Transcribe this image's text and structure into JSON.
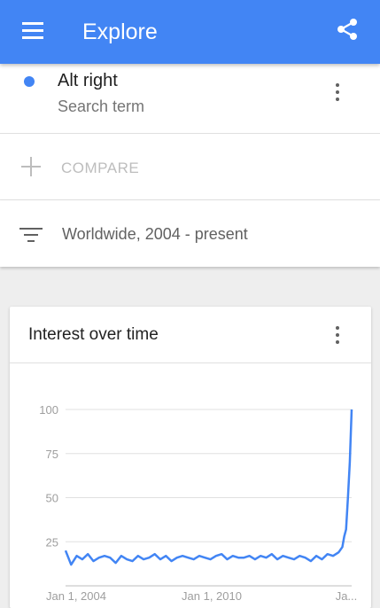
{
  "appbar": {
    "title": "Explore",
    "menu_icon": "menu-icon",
    "share_icon": "share-icon",
    "color": "#4285f4"
  },
  "search_term": {
    "name": "Alt right",
    "type": "Search term",
    "dot_color": "#4285f4"
  },
  "compare": {
    "label": "COMPARE"
  },
  "filter": {
    "label": "Worldwide, 2004 - present"
  },
  "card": {
    "title": "Interest over time"
  },
  "chart_data": {
    "type": "line",
    "title": "Interest over time",
    "xlabel": "",
    "ylabel": "",
    "ylim": [
      0,
      100
    ],
    "yticks": [
      "25",
      "50",
      "75",
      "100"
    ],
    "xticks": [
      "Jan 1, 2004",
      "Jan 1, 2010",
      "Ja..."
    ],
    "grid": true,
    "series": [
      {
        "color": "#4285f4",
        "x": [
          "2004-01",
          "2004-04",
          "2004-07",
          "2004-10",
          "2005-01",
          "2005-04",
          "2005-07",
          "2005-10",
          "2006-01",
          "2006-04",
          "2006-07",
          "2006-10",
          "2007-01",
          "2007-04",
          "2007-07",
          "2007-10",
          "2008-01",
          "2008-04",
          "2008-07",
          "2008-10",
          "2009-01",
          "2009-04",
          "2009-07",
          "2009-10",
          "2010-01",
          "2010-04",
          "2010-07",
          "2010-10",
          "2011-01",
          "2011-04",
          "2011-07",
          "2011-10",
          "2012-01",
          "2012-04",
          "2012-07",
          "2012-10",
          "2013-01",
          "2013-04",
          "2013-07",
          "2013-10",
          "2014-01",
          "2014-04",
          "2014-07",
          "2014-10",
          "2015-01",
          "2015-04",
          "2015-07",
          "2015-10",
          "2016-01",
          "2016-04",
          "2016-06",
          "2016-07",
          "2016-08",
          "2016-09",
          "2016-10",
          "2016-11"
        ],
        "values": [
          20,
          12,
          17,
          15,
          18,
          14,
          16,
          17,
          16,
          13,
          17,
          15,
          14,
          17,
          15,
          16,
          18,
          15,
          17,
          14,
          16,
          17,
          16,
          15,
          17,
          16,
          15,
          17,
          18,
          15,
          17,
          16,
          16,
          17,
          15,
          17,
          16,
          18,
          15,
          17,
          16,
          15,
          17,
          16,
          14,
          17,
          15,
          18,
          17,
          19,
          22,
          28,
          32,
          50,
          70,
          100
        ]
      }
    ]
  }
}
